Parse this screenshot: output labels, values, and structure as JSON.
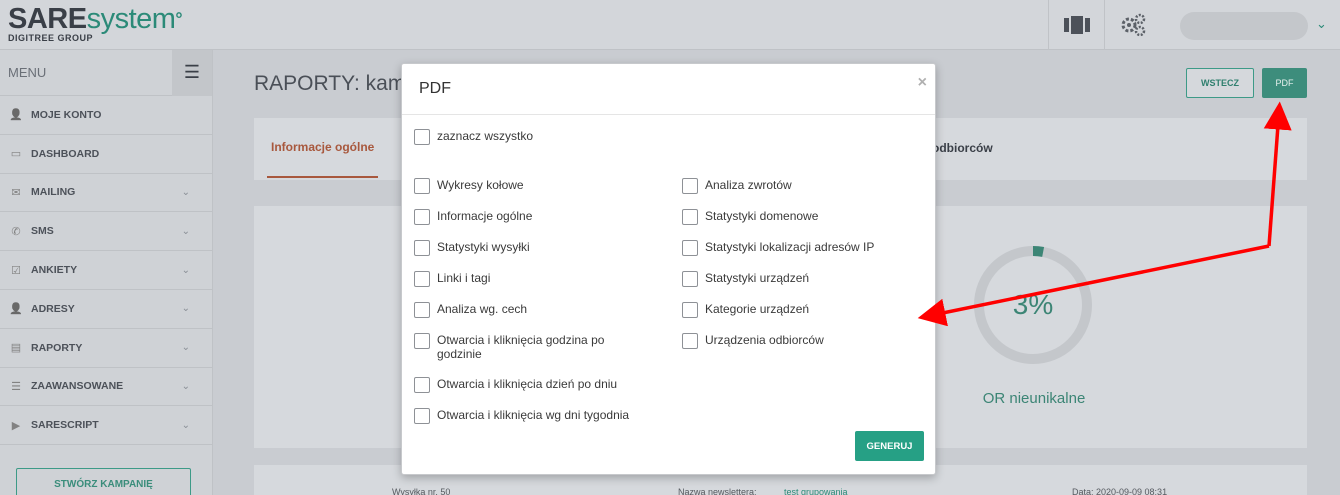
{
  "logo": {
    "bold": "SARE",
    "light": "system",
    "mark": "°",
    "sub": "DIGITREE GROUP"
  },
  "topbar": {
    "icons": [
      "columns-icon",
      "gears-icon"
    ],
    "chevron": "⌄"
  },
  "sidebar": {
    "menu_label": "MENU",
    "hamburger": "☰",
    "items": [
      {
        "label": "MOJE KONTO",
        "icon": "user-icon",
        "chevron": false
      },
      {
        "label": "DASHBOARD",
        "icon": "monitor-icon",
        "chevron": false
      },
      {
        "label": "MAILING",
        "icon": "envelope-icon",
        "chevron": true
      },
      {
        "label": "SMS",
        "icon": "phone-icon",
        "chevron": true
      },
      {
        "label": "ANKIETY",
        "icon": "checkbox-icon",
        "chevron": true
      },
      {
        "label": "ADRESY",
        "icon": "user-icon",
        "chevron": true
      },
      {
        "label": "RAPORTY",
        "icon": "report-icon",
        "chevron": true
      },
      {
        "label": "ZAAWANSOWANE",
        "icon": "list-icon",
        "chevron": true
      },
      {
        "label": "SARESCRIPT",
        "icon": "play-icon",
        "chevron": true
      }
    ],
    "create_button": "STWÓRZ KAMPANIĘ"
  },
  "main": {
    "title": "RAPORTY: kamp",
    "back_button": "WSTECZ",
    "pdf_button": "PDF",
    "tab_active": "Informacje ogólne",
    "tab_right": "odbiorców",
    "gauge": {
      "value": "3%",
      "fraction": 0.03,
      "label": "OR nieunikalne"
    },
    "footer": {
      "shipment": "Wysyłka nr. 50",
      "newsletter_label": "Nazwa newslettera:",
      "newsletter_value": "test grupowania",
      "date": "Data: 2020-09-09 08:31"
    }
  },
  "modal": {
    "title": "PDF",
    "close": "×",
    "select_all": "zaznacz wszystko",
    "left_options": [
      "Wykresy kołowe",
      "Informacje ogólne",
      "Statystyki wysyłki",
      "Linki i tagi",
      "Analiza wg. cech",
      "Otwarcia i kliknięcia godzina po godzinie",
      "Otwarcia i kliknięcia dzień po dniu",
      "Otwarcia i kliknięcia wg dni tygodnia"
    ],
    "right_options": [
      "Analiza zwrotów",
      "Statystyki domenowe",
      "Statystyki lokalizacji adresów IP",
      "Statystyki urządzeń",
      "Kategorie urządzeń",
      "Urządzenia odbiorców"
    ],
    "generate_button": "GENERUJ"
  },
  "colors": {
    "accent": "#26a085",
    "arrow": "#ff0000",
    "tab_active": "#a8583d"
  }
}
